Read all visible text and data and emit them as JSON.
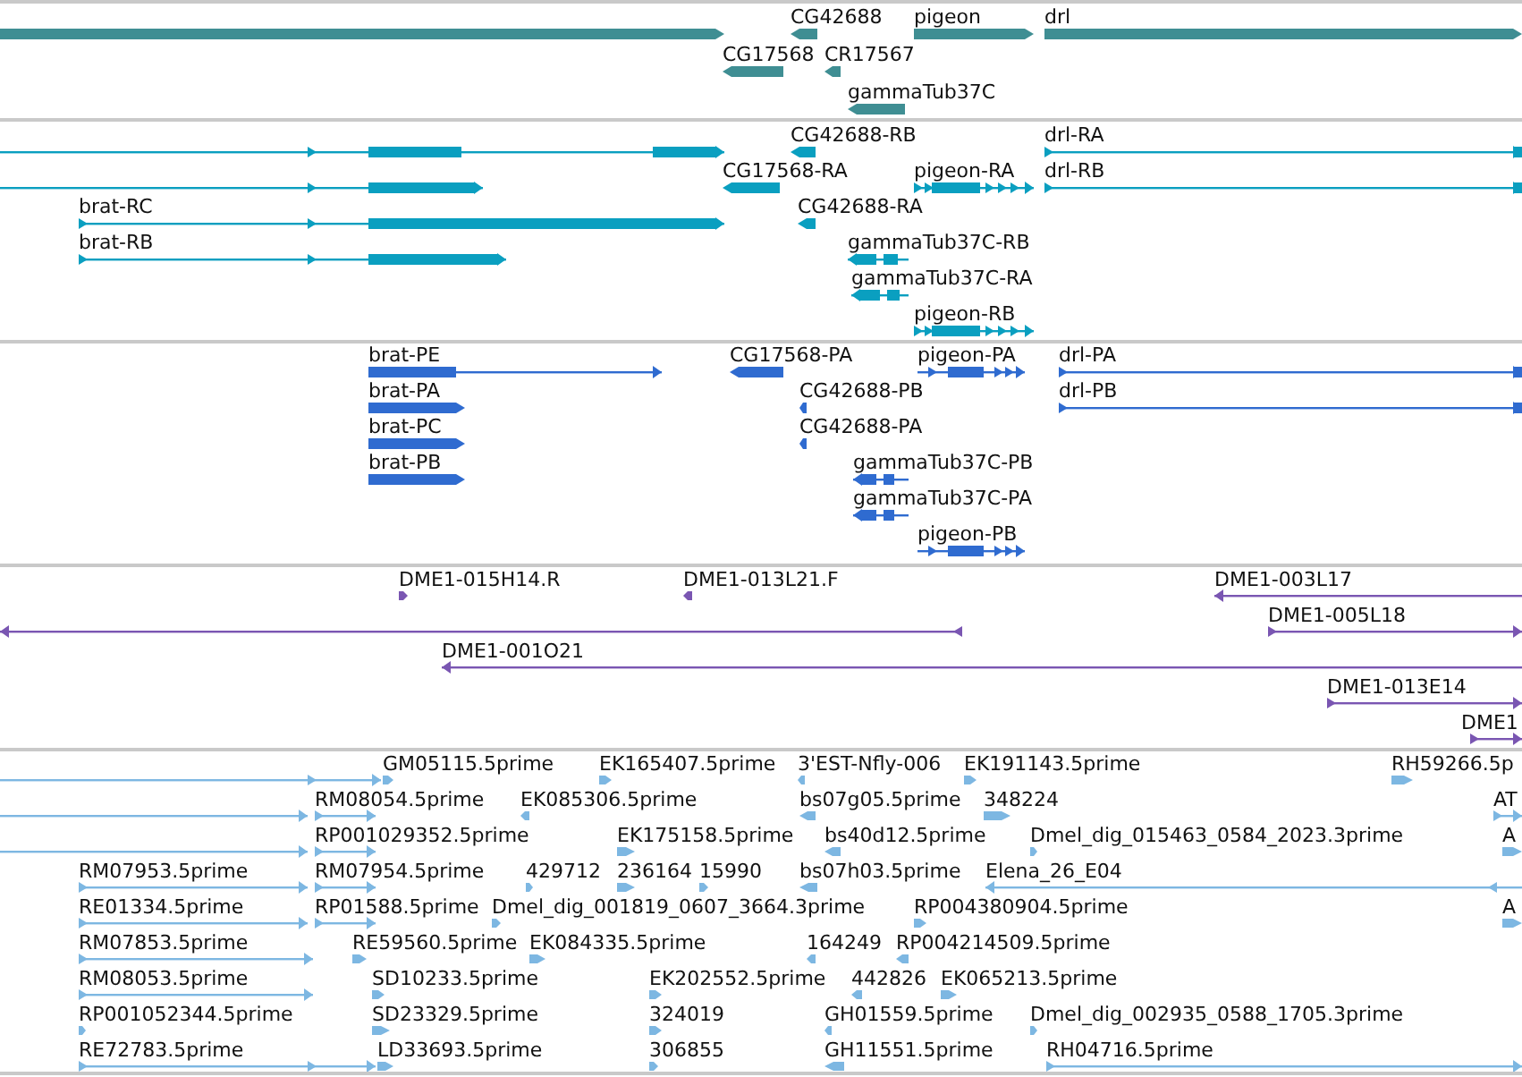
{
  "tracks": [
    {
      "kind": "gene",
      "features": [
        {
          "reverse": false
        },
        {
          "label": "CG42688",
          "reverse": true
        },
        {
          "label": "pigeon",
          "reverse": false
        },
        {
          "label": "drl",
          "reverse": false
        },
        {
          "label": "CG17568",
          "reverse": true
        },
        {
          "label": "CR17567",
          "reverse": true
        },
        {
          "label": "gammaTub37C",
          "reverse": true
        }
      ]
    },
    {
      "kind": "transcript",
      "features": [
        {
          "reverse": false
        },
        {
          "label": "CG42688-RB",
          "reverse": true
        },
        {
          "label": "drl-RA",
          "reverse": false
        },
        {
          "reverse": false
        },
        {
          "label": "CG17568-RA",
          "reverse": true
        },
        {
          "label": "pigeon-RA",
          "reverse": false
        },
        {
          "label": "drl-RB",
          "reverse": false
        },
        {
          "label": "brat-RC",
          "reverse": false
        },
        {
          "label": "CG42688-RA",
          "reverse": true
        },
        {
          "label": "brat-RB",
          "reverse": false
        },
        {
          "label": "gammaTub37C-RB",
          "reverse": true
        },
        {
          "label": "gammaTub37C-RA",
          "reverse": true
        },
        {
          "label": "pigeon-RB",
          "reverse": false
        }
      ]
    },
    {
      "kind": "protein",
      "features": [
        {
          "label": "brat-PE",
          "reverse": false
        },
        {
          "label": "CG17568-PA",
          "reverse": true
        },
        {
          "label": "pigeon-PA",
          "reverse": false
        },
        {
          "label": "drl-PA",
          "reverse": false
        },
        {
          "label": "brat-PA",
          "reverse": false
        },
        {
          "label": "CG42688-PB",
          "reverse": true
        },
        {
          "label": "drl-PB",
          "reverse": false
        },
        {
          "label": "brat-PC",
          "reverse": false
        },
        {
          "label": "CG42688-PA",
          "reverse": true
        },
        {
          "label": "brat-PB",
          "reverse": false
        },
        {
          "label": "gammaTub37C-PB",
          "reverse": true
        },
        {
          "label": "gammaTub37C-PA",
          "reverse": true
        },
        {
          "label": "pigeon-PB",
          "reverse": false
        }
      ]
    },
    {
      "kind": "clone-end",
      "features": [
        {
          "label": "DME1-015H14.R",
          "reverse": false
        },
        {
          "label": "DME1-013L21.F",
          "reverse": true
        },
        {
          "label": "DME1-003L17",
          "reverse": true
        },
        {
          "reverse": true
        },
        {
          "label": "DME1-005L18",
          "reverse": false
        },
        {
          "label": "DME1-001O21",
          "reverse": true
        },
        {
          "label": "DME1-013E14",
          "reverse": false
        },
        {
          "label": "DME1",
          "reverse": false
        }
      ]
    },
    {
      "kind": "est",
      "features": [
        {
          "reverse": false
        },
        {
          "label": "GM05115.5prime",
          "reverse": false
        },
        {
          "label": "EK165407.5prime",
          "reverse": false
        },
        {
          "label": "3'EST-Nfly-006",
          "reverse": true
        },
        {
          "label": "EK191143.5prime",
          "reverse": false
        },
        {
          "label": "RH59266.5p",
          "reverse": false
        },
        {
          "reverse": false
        },
        {
          "label": "RM08054.5prime",
          "reverse": false
        },
        {
          "label": "EK085306.5prime",
          "reverse": true
        },
        {
          "label": "bs07g05.5prime",
          "reverse": true
        },
        {
          "label": "348224",
          "reverse": false
        },
        {
          "label": "AT",
          "reverse": false
        },
        {
          "reverse": false
        },
        {
          "label": "RP001029352.5prime",
          "reverse": false
        },
        {
          "label": "EK175158.5prime",
          "reverse": false
        },
        {
          "label": "bs40d12.5prime",
          "reverse": true
        },
        {
          "label": "Dmel_dig_015463_0584_2023.3prime",
          "reverse": false
        },
        {
          "label": "A",
          "reverse": false
        },
        {
          "label": "RM07953.5prime",
          "reverse": false
        },
        {
          "label": "RM07954.5prime",
          "reverse": false
        },
        {
          "label": "429712",
          "reverse": false
        },
        {
          "label": "236164",
          "reverse": false
        },
        {
          "label": "15990",
          "reverse": false
        },
        {
          "label": "bs07h03.5prime",
          "reverse": true
        },
        {
          "label": "Elena_26_E04",
          "reverse": true
        },
        {
          "label": "RE01334.5prime",
          "reverse": false
        },
        {
          "label": "RP01588.5prime",
          "reverse": false
        },
        {
          "label": "Dmel_dig_001819_0607_3664.3prime",
          "reverse": false
        },
        {
          "label": "RP004380904.5prime",
          "reverse": false
        },
        {
          "label": "A",
          "reverse": false
        },
        {
          "label": "RM07853.5prime",
          "reverse": false
        },
        {
          "label": "RE59560.5prime",
          "reverse": false
        },
        {
          "label": "EK084335.5prime",
          "reverse": false
        },
        {
          "label": "164249",
          "reverse": true
        },
        {
          "label": "RP004214509.5prime",
          "reverse": true
        },
        {
          "label": "RM08053.5prime",
          "reverse": false
        },
        {
          "label": "SD10233.5prime",
          "reverse": false
        },
        {
          "label": "EK202552.5prime",
          "reverse": false
        },
        {
          "label": "442826",
          "reverse": true
        },
        {
          "label": "EK065213.5prime",
          "reverse": false
        },
        {
          "label": "RP001052344.5prime",
          "reverse": false
        },
        {
          "label": "SD23329.5prime",
          "reverse": false
        },
        {
          "label": "324019",
          "reverse": false
        },
        {
          "label": "GH01559.5prime",
          "reverse": true
        },
        {
          "label": "Dmel_dig_002935_0588_1705.3prime",
          "reverse": false
        },
        {
          "label": "RE72783.5prime",
          "reverse": false
        },
        {
          "label": "LD33693.5prime",
          "reverse": false
        },
        {
          "label": "306855",
          "reverse": false
        },
        {
          "label": "GH11551.5prime",
          "reverse": true
        },
        {
          "label": "RH04716.5prime",
          "reverse": false
        }
      ]
    }
  ]
}
